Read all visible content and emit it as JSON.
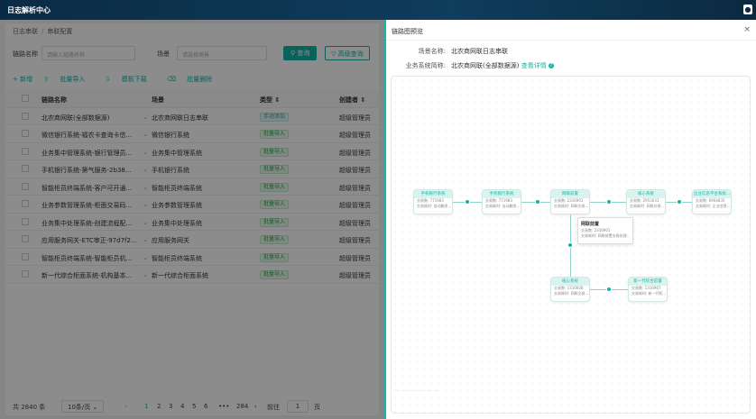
{
  "app": {
    "title": "日志解析中心",
    "user_icon": "user-icon"
  },
  "breadcrumb": {
    "items": [
      "日志串联",
      "串联配置"
    ]
  },
  "filter": {
    "name_label": "链路名称",
    "name_placeholder": "请输入链路名称",
    "scene_label": "场景",
    "scene_placeholder": "请选择场景",
    "search_button": "查询",
    "advanced_button": "高级查询"
  },
  "actions": {
    "add": "+ 新增",
    "import": "批量导入",
    "download": "模板下载",
    "delete": "批量删除"
  },
  "table": {
    "columns": [
      "链路名称",
      "场景",
      "类型",
      "创建者"
    ],
    "rows": [
      {
        "name": "北农商网联(全部数据源)",
        "scene": "北农商网联日志串联",
        "type": "手动添加",
        "creator": "超级管理员"
      },
      {
        "name": "微信银行系统-福农卡查询卡信...",
        "scene": "微信银行系统",
        "type": "批量导入",
        "creator": "超级管理员"
      },
      {
        "name": "业务集中管理系统-银行管理员...",
        "scene": "业务集中管理系统",
        "type": "批量导入",
        "creator": "超级管理员"
      },
      {
        "name": "手机银行系统-第气服务-2b38...",
        "scene": "手机银行系统",
        "type": "批量导入",
        "creator": "超级管理员"
      },
      {
        "name": "智能柜员终端系统-客户可开通...",
        "scene": "智能柜员终端系统",
        "type": "批量导入",
        "creator": "超级管理员"
      },
      {
        "name": "业务参数管理系统-柜面交易码...",
        "scene": "业务参数管理系统",
        "type": "批量导入",
        "creator": "超级管理员"
      },
      {
        "name": "业务集中处理系统-创建流程配...",
        "scene": "业务集中处理系统",
        "type": "批量导入",
        "creator": "超级管理员"
      },
      {
        "name": "应用服务网关-ETC审正-97d7f2...",
        "scene": "应用服务网关",
        "type": "批量导入",
        "creator": "超级管理员"
      },
      {
        "name": "智能柜员终端系统-智能柜员机...",
        "scene": "智能柜员终端系统",
        "type": "批量导入",
        "creator": "超级管理员"
      },
      {
        "name": "新一代综合柜面系统-机构基本...",
        "scene": "新一代综合柜面系统",
        "type": "批量导入",
        "creator": "超级管理员"
      }
    ]
  },
  "pager": {
    "total": "共 2840 条",
    "page_size": "10条/页",
    "pages": [
      "1",
      "2",
      "3",
      "4",
      "5",
      "6",
      "•••",
      "284"
    ],
    "goto_label": "前往",
    "goto_value": "1",
    "page_suffix": "页"
  },
  "drawer": {
    "title": "链路图预览",
    "scene_label": "场景名称:",
    "scene_value": "北农商网联日志串联",
    "system_label": "业务系统简称:",
    "system_value": "北农商网联(全部数据源)",
    "detail_link": "查看详情",
    "nodes": [
      {
        "title": "手机银行系统",
        "l1": "交易数: 771983",
        "l2": "交易耗时: 自动触发..."
      },
      {
        "title": "手机银行系统",
        "l1": "交易数: 771983",
        "l2": "交易耗时: 自动触发..."
      },
      {
        "title": "网联前置",
        "l1": "交易数: 2316901",
        "l2": "交易耗时: 网联交易..."
      },
      {
        "title": "核心系统",
        "l1": "交易数: 2953031",
        "l2": "交易耗时: 网联交易..."
      },
      {
        "title": "企业信息平台系统...",
        "l1": "交易数: 6964835",
        "l2": "交易耗时: 企业信息..."
      },
      {
        "title": "核心系统",
        "l1": "交易数: 1316608",
        "l2": "交易耗时: 网联交易..."
      },
      {
        "title": "新一代综合前置",
        "l1": "交易数: 1316967",
        "l2": "交易耗时: 新一代柜..."
      }
    ],
    "tooltip": {
      "title": "网联前置",
      "l1": "交易数: 2316901",
      "l2": "交易耗时: 网联前置交易处理..."
    },
    "minimap": "— — — — — —"
  }
}
